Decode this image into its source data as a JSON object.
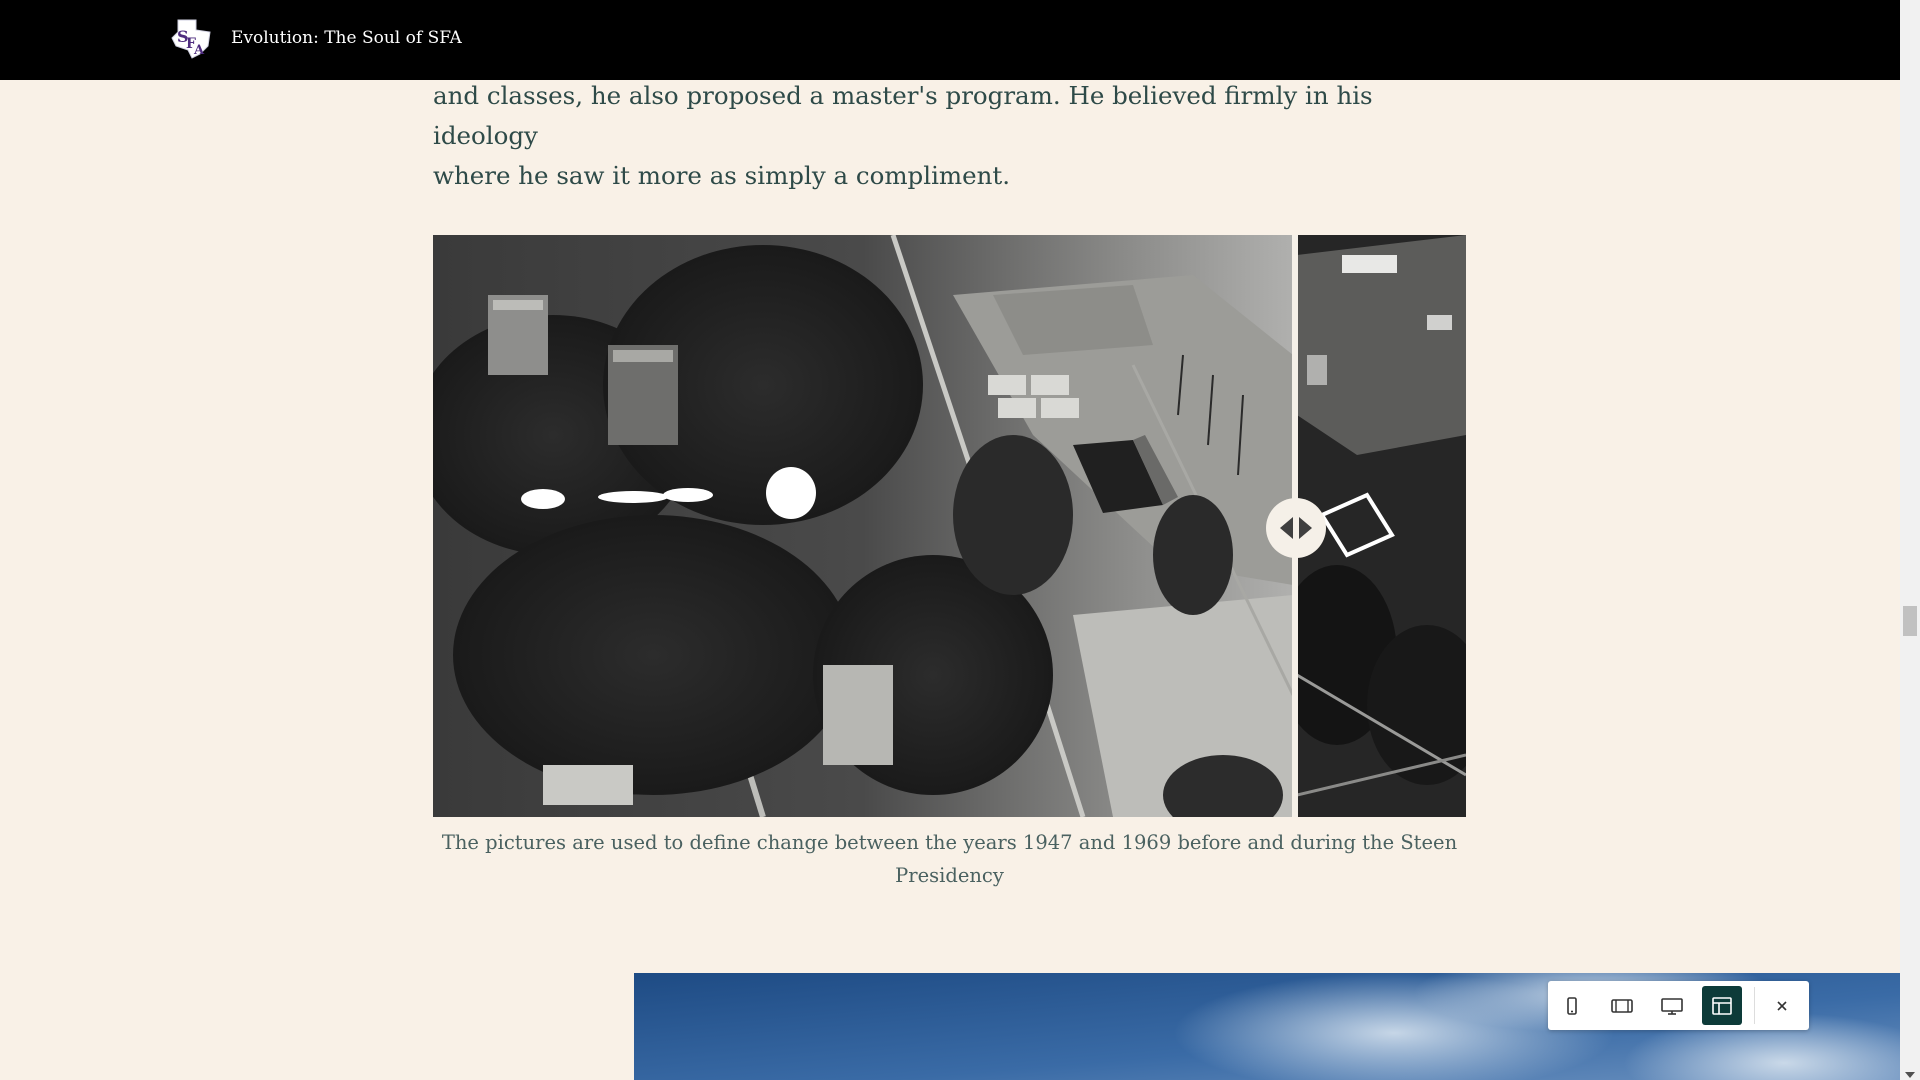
{
  "header": {
    "site_title": "Evolution: The Soul of SFA",
    "logo_icon": "sfa-logo-icon"
  },
  "article": {
    "paragraph_lines": [
      "and classes, he also proposed a master's program. He believed firmly in his ideology",
      "where he saw it more as simply a compliment."
    ],
    "comparison": {
      "caption": "The pictures are used to define change between the years 1947 and 1969 before and during the Steen Presidency",
      "handle_icon": "left-right-arrows-icon",
      "slider_position_percent": 83
    }
  },
  "toolbar": {
    "buttons": [
      {
        "name": "mobile-view",
        "icon": "phone-icon",
        "active": false
      },
      {
        "name": "tablet-view",
        "icon": "tablet-icon",
        "active": false
      },
      {
        "name": "desktop-view",
        "icon": "monitor-icon",
        "active": false
      },
      {
        "name": "full-width-view",
        "icon": "layout-icon",
        "active": true
      }
    ],
    "close_icon": "close-icon"
  },
  "colors": {
    "background": "#f9f1e7",
    "navbar": "#000000",
    "text": "#2e4a48",
    "toolbar_active": "#0d3b39",
    "logo_purple": "#4f2d7f"
  }
}
